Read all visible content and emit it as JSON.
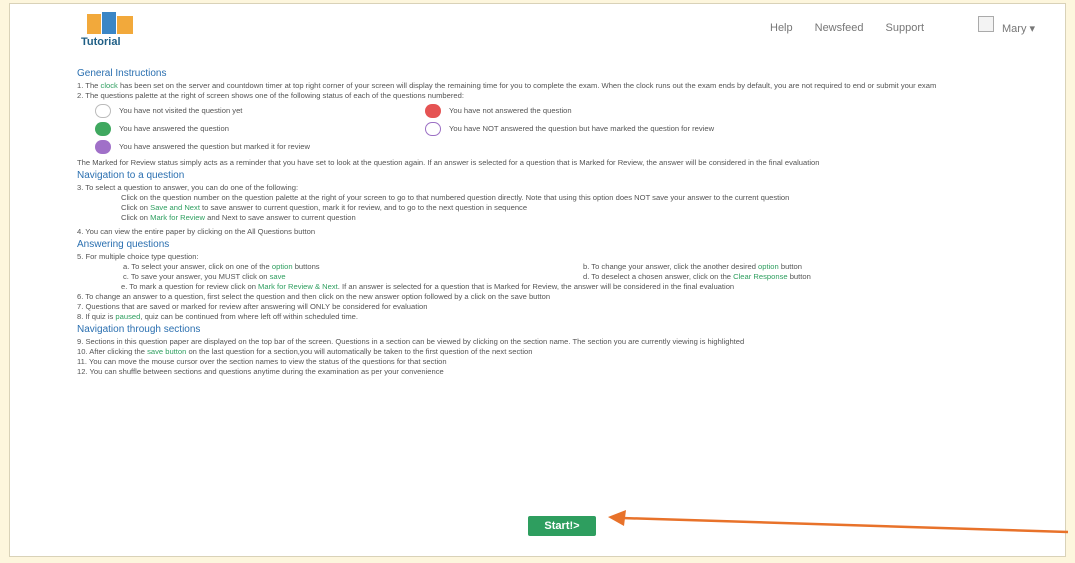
{
  "header": {
    "logo_text": "Tutorial",
    "nav": [
      "Help",
      "Newsfeed",
      "Support"
    ],
    "user": "Mary"
  },
  "instructions": {
    "general_heading": "General Instructions",
    "p1a": "1. The ",
    "p1_link": "clock",
    "p1b": " has been set on the server and countdown timer at top right corner of your screen will display the remaining time for you to complete the exam. When the clock runs out the exam ends by default, you are not required to end or submit your exam",
    "p2": "2. The questions palette at the right of screen shows one of the following status of each of the questions numbered:",
    "legend": [
      {
        "icon": "white",
        "text": "You have not visited the question yet"
      },
      {
        "icon": "red",
        "text": "You have not answered the question"
      },
      {
        "icon": "green",
        "text": "You have answered the question"
      },
      {
        "icon": "outline",
        "text": "You have NOT answered the question but have marked the question for review"
      },
      {
        "icon": "purple",
        "text": "You have answered the question but marked it for review"
      }
    ],
    "marked_note": "The Marked for Review status simply acts as a reminder that you have set to look at the question again. If an answer is selected for a question that is Marked for Review, the answer will be considered in the final evaluation",
    "nav_heading": "Navigation to a question",
    "p3": "3. To select a question to answer, you can do one of the following:",
    "p3a": "Click on the question number on the question palette at the right of your screen to go to that numbered question directly. Note that using this option does NOT save your answer to the current question",
    "p3b_pre": "Click on ",
    "p3b_link": "Save and Next",
    "p3b_post": " to save answer to current question, mark it for review, and to go to the next question in sequence",
    "p3c_pre": "Click on ",
    "p3c_link": "Mark for Review",
    "p3c_post": " and Next to save answer to current question",
    "p4": "4. You can view the entire paper by clicking on the All Questions button",
    "ans_heading": "Answering questions",
    "p5": "5. For multiple choice type question:",
    "p5a_pre": "a. To select your answer, click on one of the ",
    "p5a_link": "option",
    "p5a_post": " buttons",
    "p5b_pre": "b. To change your answer, click the another desired ",
    "p5b_link": "option",
    "p5b_post": " button",
    "p5c_pre": "c. To save your answer, you MUST click on ",
    "p5c_link": "save",
    "p5d_pre": "d. To deselect a chosen answer, click on the ",
    "p5d_link": "Clear Response",
    "p5d_post": " button",
    "p5e_pre": "e. To mark a question for review click on ",
    "p5e_link": "Mark for Review & Next",
    "p5e_post": ". If an answer is selected for a question that is Marked for Review, the answer will be considered in the final evaluation",
    "p6": "6. To change an answer to a question, first select the question and then click on the new answer option followed by a click on the save button",
    "p7": "7. Questions that are saved or marked for review after answering will ONLY be considered for evaluation",
    "p8_pre": "8. If quiz is ",
    "p8_link": "paused",
    "p8_post": ", quiz can be continued from where left off within scheduled time.",
    "sec_heading": "Navigation through sections",
    "p9": "9. Sections in this question paper are displayed on the top bar of the screen. Questions in a section can be viewed by clicking on the section name. The section you are currently viewing is highlighted",
    "p10_pre": "10. After clicking the ",
    "p10_link": "save button",
    "p10_post": " on the last question for a section,you will automatically be taken to the first question of the next section",
    "p11": "11. You can move the mouse cursor over the section names to view the status of the questions for that section",
    "p12": "12. You can shuffle between sections and questions anytime during the examination as per your convenience"
  },
  "start_button": "Start!>",
  "colors": {
    "accent_green": "#2e9e5f",
    "heading_blue": "#2a6fb0",
    "arrow": "#e8722a"
  }
}
